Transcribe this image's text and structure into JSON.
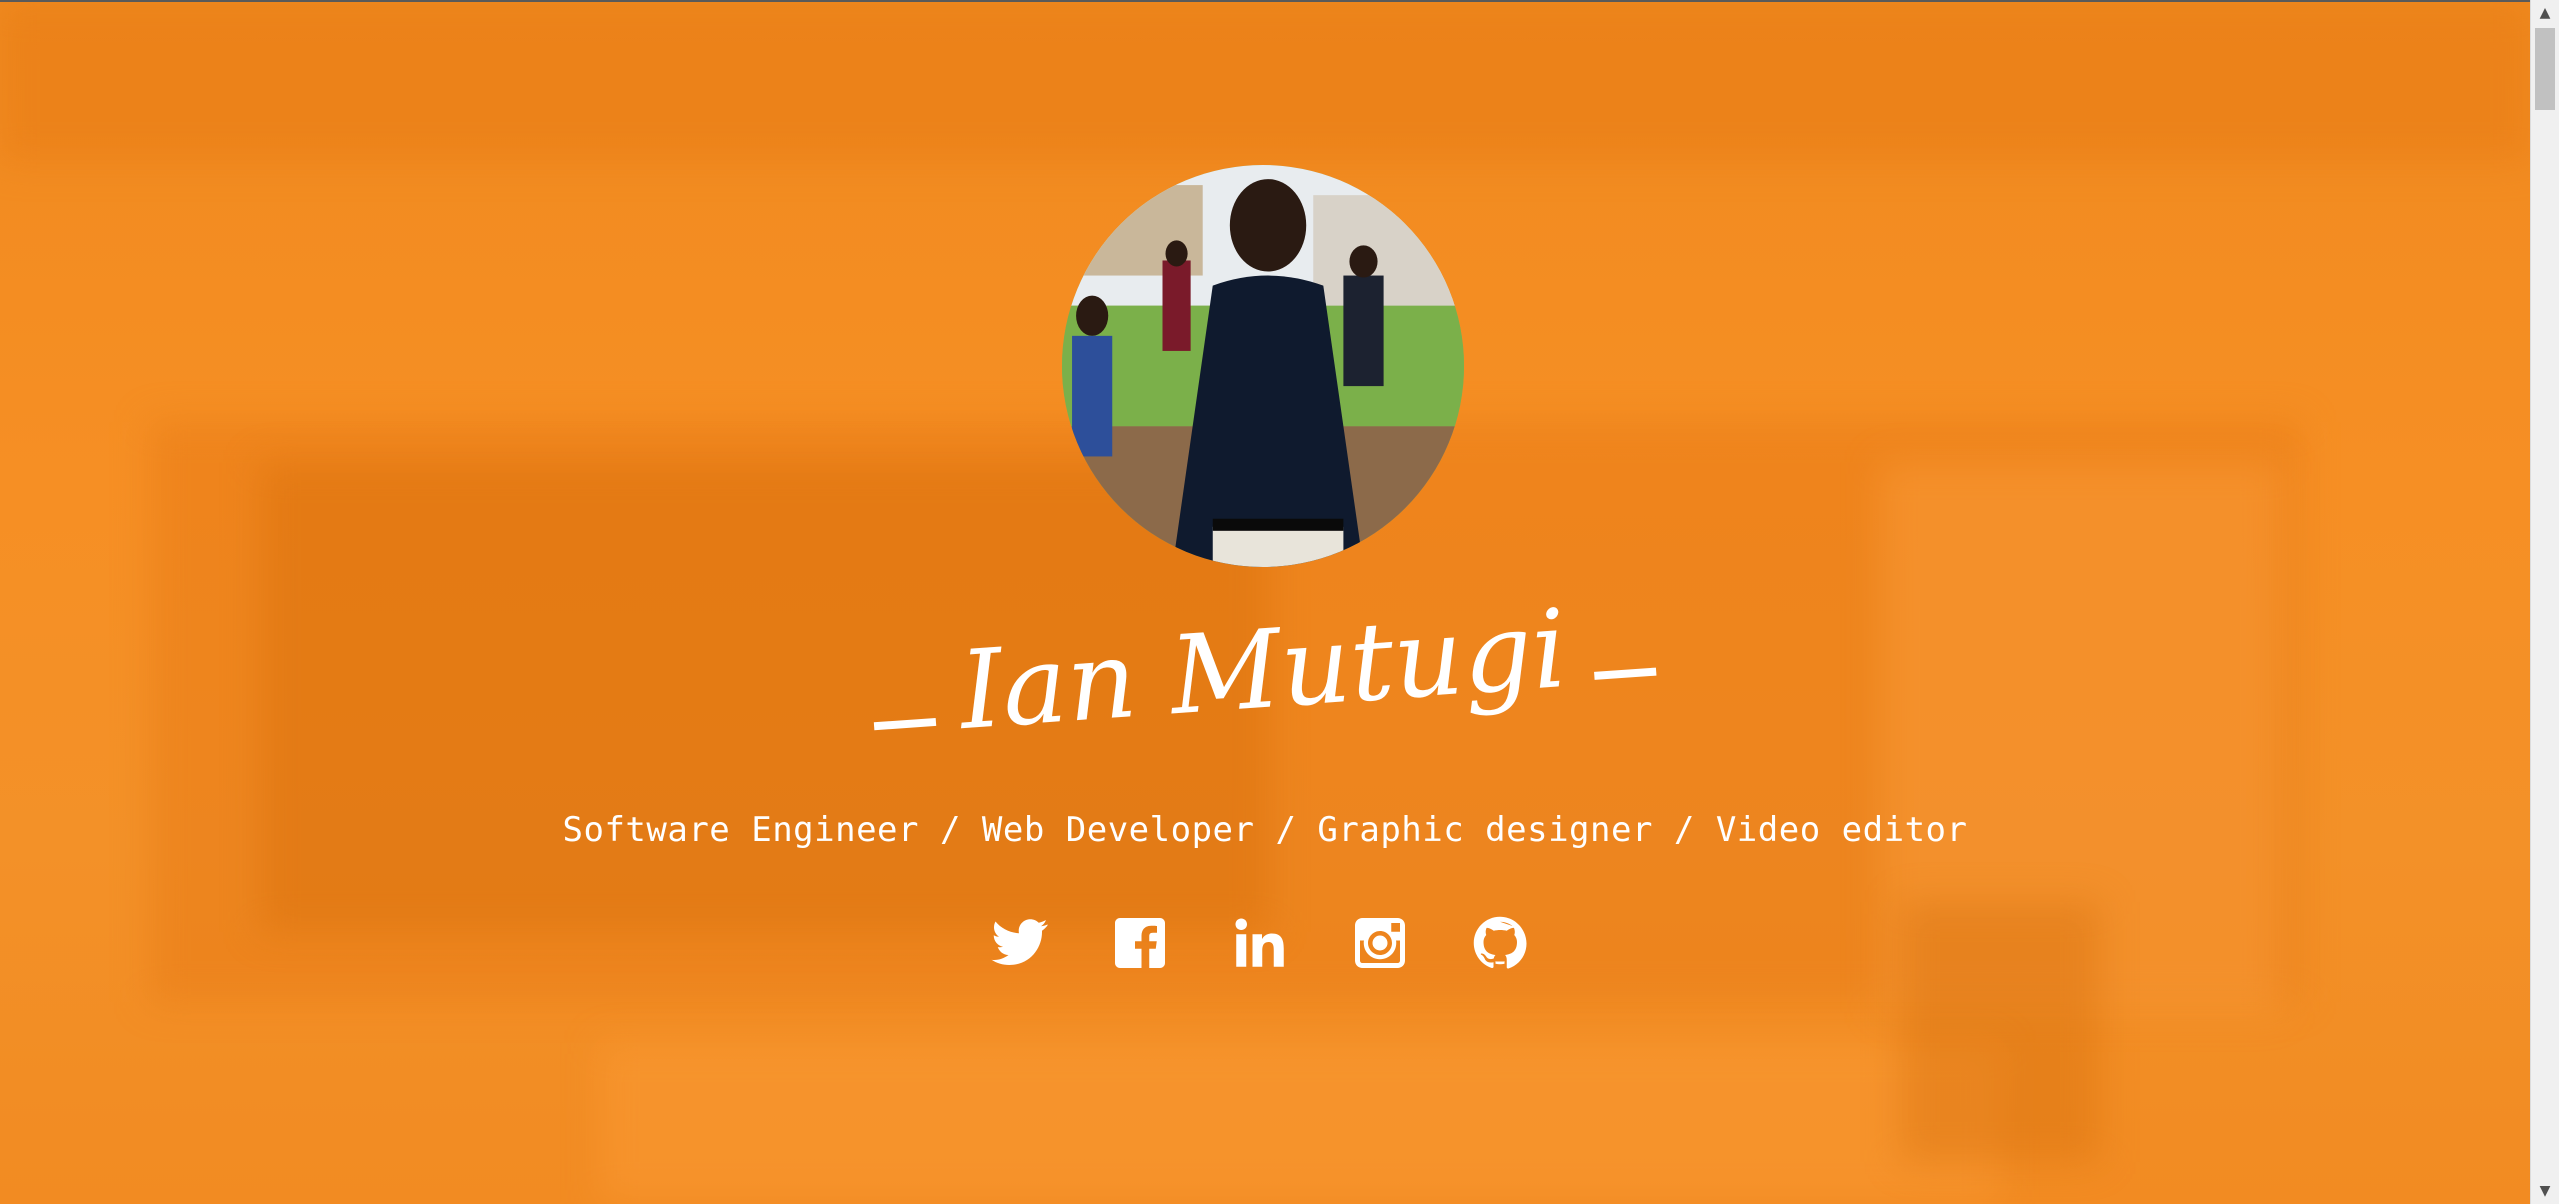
{
  "profile": {
    "name": "Ian Mutugi",
    "tagline": "Software Engineer / Web Developer / Graphic designer / Video editor",
    "avatar_alt": "Profile photo"
  },
  "socials": [
    {
      "label": "Twitter",
      "icon": "twitter-icon"
    },
    {
      "label": "Facebook",
      "icon": "facebook-icon"
    },
    {
      "label": "LinkedIn",
      "icon": "linkedin-icon"
    },
    {
      "label": "Instagram",
      "icon": "instagram-icon"
    },
    {
      "label": "GitHub",
      "icon": "github-icon"
    }
  ],
  "colors": {
    "background": "#f68f24",
    "text": "#ffffff",
    "scrollbar_track": "#f0f0f0",
    "scrollbar_thumb": "#c1c1c1"
  },
  "scrollbar": {
    "up_arrow": "▲",
    "down_arrow": "▼"
  }
}
